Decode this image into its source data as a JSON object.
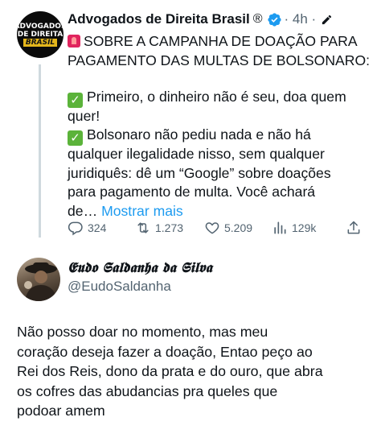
{
  "parent_tweet": {
    "avatar_text": [
      "ADVOGADOS",
      "DE DIREITA",
      "BRASIL"
    ],
    "author_name": "Advogados de Direita Brasil",
    "registered_mark": "®",
    "time": "· 4h ·",
    "body_lines": [
      "SOBRE A CAMPANHA DE DOAÇÃO PARA",
      "PAGAMENTO DAS MULTAS DE BOLSONARO:",
      "Primeiro, o dinheiro não é seu, doa quem",
      "quer!",
      "Bolsonaro não pediu nada e não há",
      "qualquer ilegalidade nisso, sem qualquer",
      "juridiquês: dê um “Google” sobre doações",
      "para pagamento de multa. Você achará",
      "de…"
    ],
    "show_more": "Mostrar mais",
    "stats": {
      "replies": "324",
      "retweets": "1.273",
      "likes": "5.209",
      "views": "129k"
    }
  },
  "reply_tweet": {
    "author_name": "𝕰𝖚𝖉𝖔 𝕾𝖆𝖑𝖉𝖆𝖓𝖍𝖆 𝖉𝖆 𝕾𝖎𝖑𝖛𝖆",
    "handle": "@EudoSaldanha",
    "body_lines": [
      "Não posso doar no momento, mas meu",
      "coração deseja fazer a doação, Entao peço ao",
      "Rei dos Reis, dono da prata e do ouro, que abra",
      "os cofres das abudancias pra queles que",
      "podoar amem"
    ]
  },
  "colors": {
    "text": "#0f1419",
    "secondary": "#536471",
    "link": "#1d9bf0",
    "verified": "#1d9bf0",
    "checkmark": "#5bb33a",
    "thread_line": "#cfd9de"
  }
}
